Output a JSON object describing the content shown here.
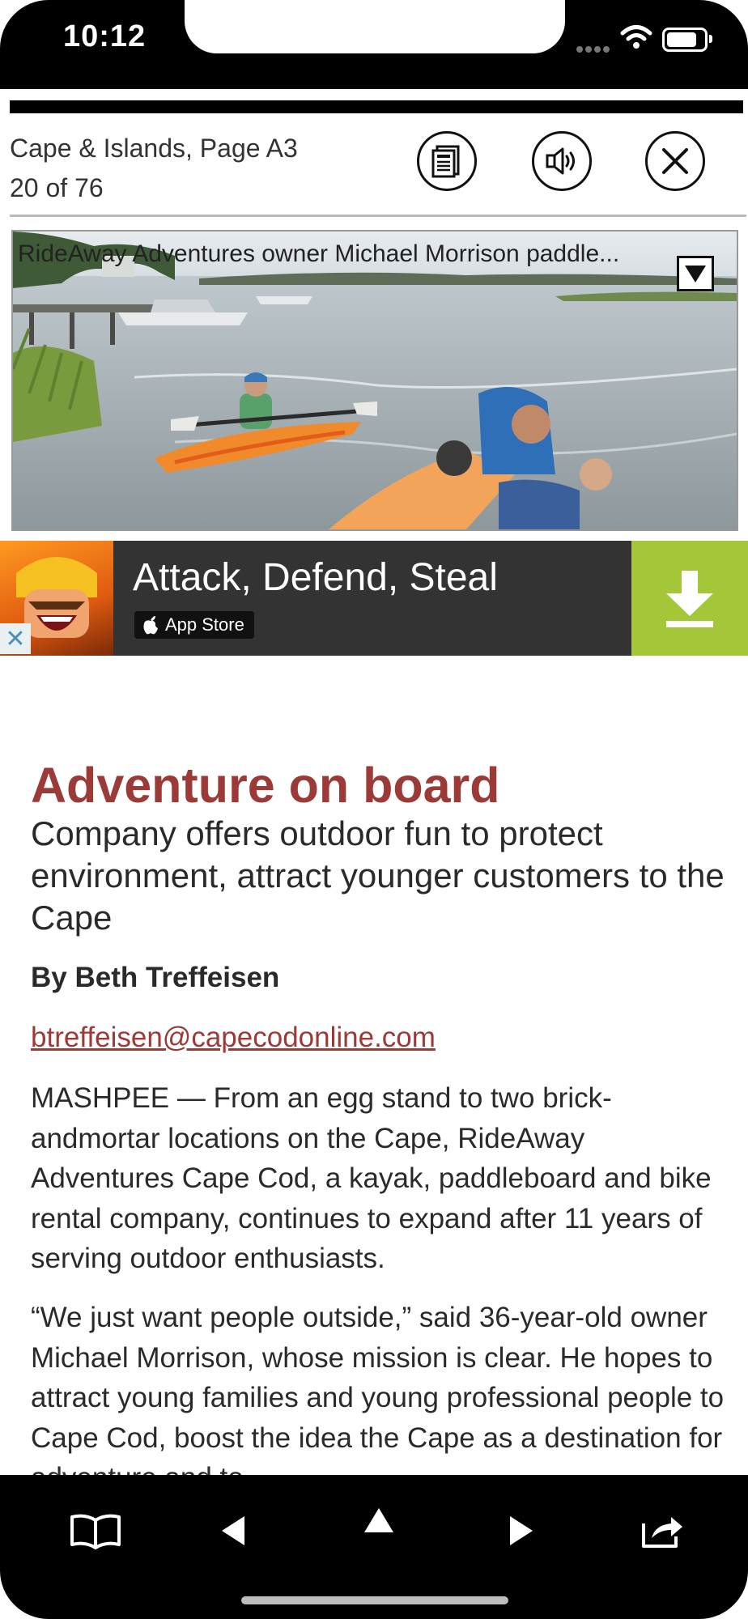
{
  "status_bar": {
    "time": "10:12"
  },
  "header": {
    "page_label": "Cape & Islands, Page A3",
    "page_count": "20 of 76",
    "buttons": [
      "article-view-icon",
      "speaker-icon",
      "close-icon"
    ]
  },
  "photo": {
    "caption": "RideAway Adventures owner Michael Morrison paddle..."
  },
  "ad": {
    "title": "Attack, Defend, Steal",
    "store_label": "App Store",
    "colors": {
      "background": "#333333",
      "download": "#a4c639"
    }
  },
  "article": {
    "headline": "Adventure on board",
    "subhead": "Company offers outdoor fun to protect environment, attract younger customers to the Cape",
    "byline": "By Beth Treffeisen",
    "email": "btreffeisen@capecodonline.com",
    "paragraphs": [
      "MASHPEE — From an egg stand to two brick-andmortar locations on the Cape, RideAway Adventures Cape Cod, a kayak, paddleboard and bike rental company, continues to expand after 11 years of serving outdoor enthusiasts.",
      "“We just want people outside,” said 36-year-old owner Michael Morrison, whose mission is clear. He hopes to attract young families and young professional people to Cape Cod, boost the idea the Cape as a destination for adventure and to"
    ],
    "accent_color": "#9b3a36"
  },
  "toolbar": {
    "items": [
      "book-icon",
      "previous-icon",
      "up-icon",
      "next-icon",
      "share-icon"
    ]
  }
}
